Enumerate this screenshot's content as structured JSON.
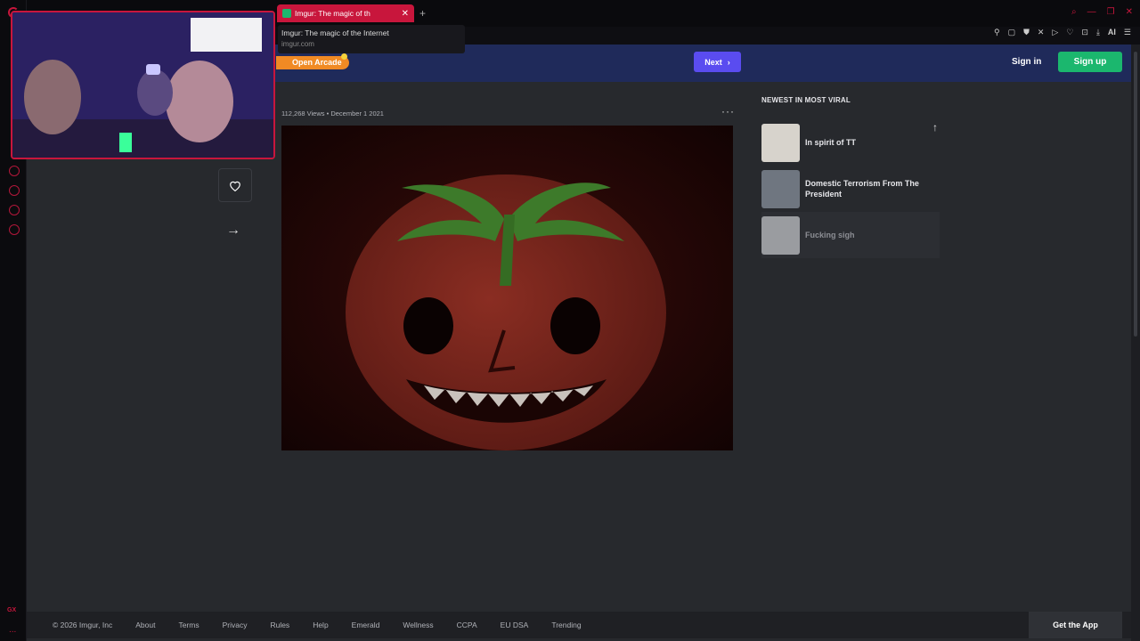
{
  "browser": {
    "tab_title": "Imgur: The magic of th",
    "tab_close": "✕",
    "new_tab": "+",
    "tooltip_title": "Imgur: The magic of the Internet",
    "tooltip_url": "imgur.com",
    "toolbar_ai": "AI",
    "sidebar_bottom": "GX",
    "sidebar_dots": "..."
  },
  "nav": {
    "arcade_label": "Open Arcade",
    "next_label": "Next",
    "next_chevron": "›",
    "signin_label": "Sign in",
    "signup_label": "Sign up"
  },
  "post": {
    "views": "112,268 Views",
    "separator": "•",
    "date": "December 1 2021",
    "more": "···",
    "share": "→"
  },
  "sidebar": {
    "title": "NEWEST IN MOST VIRAL",
    "up": "↑",
    "items": [
      {
        "label": "In spirit of TT"
      },
      {
        "label": "Domestic Terrorism From The President"
      },
      {
        "label": "Fucking sigh"
      }
    ]
  },
  "footer": {
    "copyright": "© 2026 Imgur, Inc",
    "links": [
      "About",
      "Terms",
      "Privacy",
      "Rules",
      "Help",
      "Emerald",
      "Wellness",
      "CCPA",
      "EU DSA",
      "Trending"
    ],
    "get_app": "Get the App"
  },
  "colors": {
    "accent": "#c8163c",
    "nav_bg": "#1f2a5a",
    "next": "#5a4cf0",
    "signup": "#1bb76e",
    "arcade": "#f08a24",
    "page_bg": "#27292d"
  }
}
